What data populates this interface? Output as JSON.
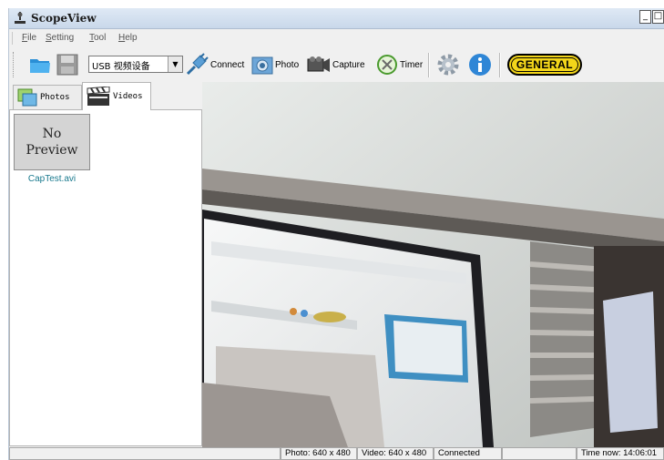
{
  "window": {
    "title": "ScopeView"
  },
  "menu": {
    "items": [
      "File",
      "Setting",
      "Tool",
      "Help"
    ]
  },
  "toolbar": {
    "device_select": "USB 视频设备",
    "connect_label": "Connect",
    "photo_label": "Photo",
    "capture_label": "Capture",
    "timer_label": "Timer",
    "logo_text": "GENERAL"
  },
  "tabs": {
    "photos_label": "Photos",
    "videos_label": "Videos"
  },
  "media_list": {
    "items": [
      {
        "preview_text": "No Preview",
        "filename": "CapTest.avi"
      }
    ]
  },
  "statusbar": {
    "photo_res": "Photo: 640 x 480",
    "video_res": "Video: 640 x 480",
    "connection": "Connected",
    "time": "Time now: 14:06:01"
  },
  "colors": {
    "logo_yellow": "#f2d51a",
    "caption_teal": "#1a7a8e",
    "title_bar": "#c9d8ea"
  },
  "icons": [
    "open-folder-icon",
    "save-icon",
    "plug-icon",
    "camera-icon",
    "video-camera-icon",
    "timer-icon",
    "settings-gear-icon",
    "info-icon"
  ]
}
